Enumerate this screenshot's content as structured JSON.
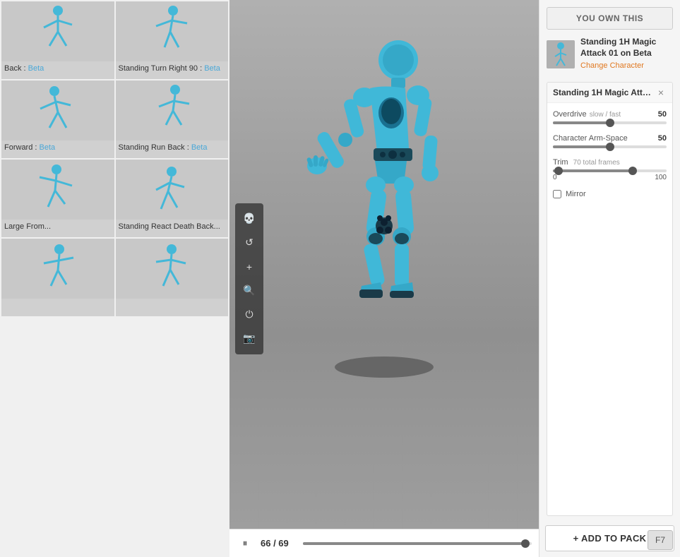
{
  "left_panel": {
    "items": [
      {
        "label": "Back",
        "beta_label": "Beta",
        "has_beta": true
      },
      {
        "label": "Standing Turn Right 90",
        "beta_label": "Beta",
        "has_beta": true
      },
      {
        "label": "Forward",
        "beta_label": "Beta",
        "has_beta": true
      },
      {
        "label": "Standing Run Back",
        "beta_label": "Beta",
        "has_beta": true
      },
      {
        "label": "Large From...",
        "beta_label": "",
        "has_beta": false
      },
      {
        "label": "Standing React Death Back...",
        "beta_label": "",
        "has_beta": false
      },
      {
        "label": "",
        "beta_label": "",
        "has_beta": false
      },
      {
        "label": "",
        "beta_label": "",
        "has_beta": false
      }
    ]
  },
  "right_panel": {
    "you_own_label": "YOU OWN THIS",
    "asset": {
      "title": "Standing 1H Magic Attack 01 on Beta",
      "change_character": "Change Character"
    },
    "animation_panel": {
      "title": "Standing 1H Magic Attac...",
      "close_label": "×",
      "overdrive": {
        "label": "Overdrive",
        "sublabel": "slow / fast",
        "value": 50,
        "fill_percent": 50
      },
      "character_arm_space": {
        "label": "Character Arm-Space",
        "value": 50,
        "fill_percent": 50
      },
      "trim": {
        "label": "Trim",
        "total_frames": "70 total frames",
        "min": 0,
        "max": 100,
        "fill_percent": 70
      },
      "mirror": {
        "label": "Mirror",
        "checked": false
      }
    },
    "add_to_pack_label": "+ ADD TO PACK",
    "f7_label": "F7"
  },
  "playback": {
    "current_frame": 66,
    "total_frames": 69,
    "frame_display": "66 / 69",
    "progress_percent": 95.6
  },
  "toolbar": {
    "skull_icon": "💀",
    "reset_icon": "↺",
    "plus_icon": "+",
    "search_icon": "🔍",
    "power_icon": "⏻",
    "camera_icon": "🎥"
  }
}
